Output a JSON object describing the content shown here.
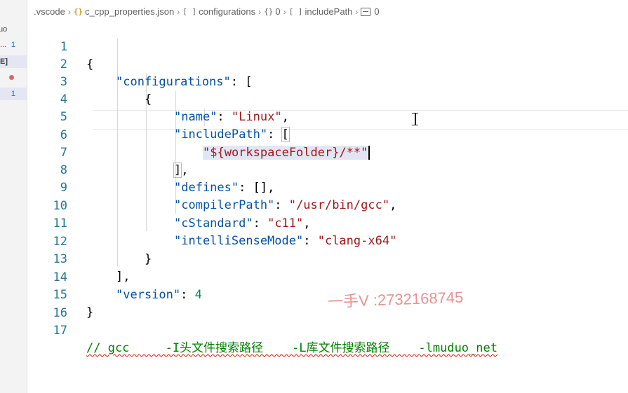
{
  "sidebar": {
    "rows": [
      {
        "text": "uo",
        "badge": ""
      },
      {
        "text": "...",
        "badge": "1"
      },
      {
        "text": "E]",
        "badge": ""
      },
      {
        "text": "",
        "badge": "dot"
      },
      {
        "text": "",
        "badge": "1"
      }
    ]
  },
  "breadcrumb": {
    "items": [
      {
        "icon": "",
        "label": ".vscode"
      },
      {
        "icon": "{}",
        "label": "c_cpp_properties.json"
      },
      {
        "icon": "[ ]",
        "label": "configurations"
      },
      {
        "icon": "{}",
        "label": "0"
      },
      {
        "icon": "[ ]",
        "label": "includePath"
      },
      {
        "icon": "box",
        "label": "0"
      }
    ]
  },
  "editor": {
    "line_numbers": [
      "1",
      "2",
      "3",
      "4",
      "5",
      "6",
      "7",
      "8",
      "9",
      "10",
      "11",
      "12",
      "13",
      "14",
      "15",
      "16",
      "17"
    ],
    "current_line": 6,
    "lines": {
      "l1_brace": "{",
      "l2_key": "\"configurations\"",
      "l2_rest": ": [",
      "l3": "{",
      "l4_key": "\"name\"",
      "l4_val": "\"Linux\"",
      "l5_key": "\"includePath\"",
      "l5_bracket": "[",
      "l6_val": "\"${workspaceFolder}/**\"",
      "l7_bracket": "]",
      "l7_rest": ",",
      "l8_key": "\"defines\"",
      "l8_rest": ": [],",
      "l9_key": "\"compilerPath\"",
      "l9_val": "\"/usr/bin/gcc\"",
      "l10_key": "\"cStandard\"",
      "l10_val": "\"c11\"",
      "l11_key": "\"intelliSenseMode\"",
      "l11_val": "\"clang-x64\"",
      "l12": "}",
      "l13": "],",
      "l14_key": "\"version\"",
      "l14_val": "4",
      "l15": "}",
      "l16": "",
      "l17_comment": "// gcc     -I头文件搜索路径    -L库文件搜索路径    -lmuduo_net"
    }
  },
  "watermark": "一手V :2732168745",
  "colors": {
    "key": "#0451a5",
    "string": "#a31515",
    "number": "#098658",
    "comment": "#008000",
    "line_number": "#237893"
  }
}
